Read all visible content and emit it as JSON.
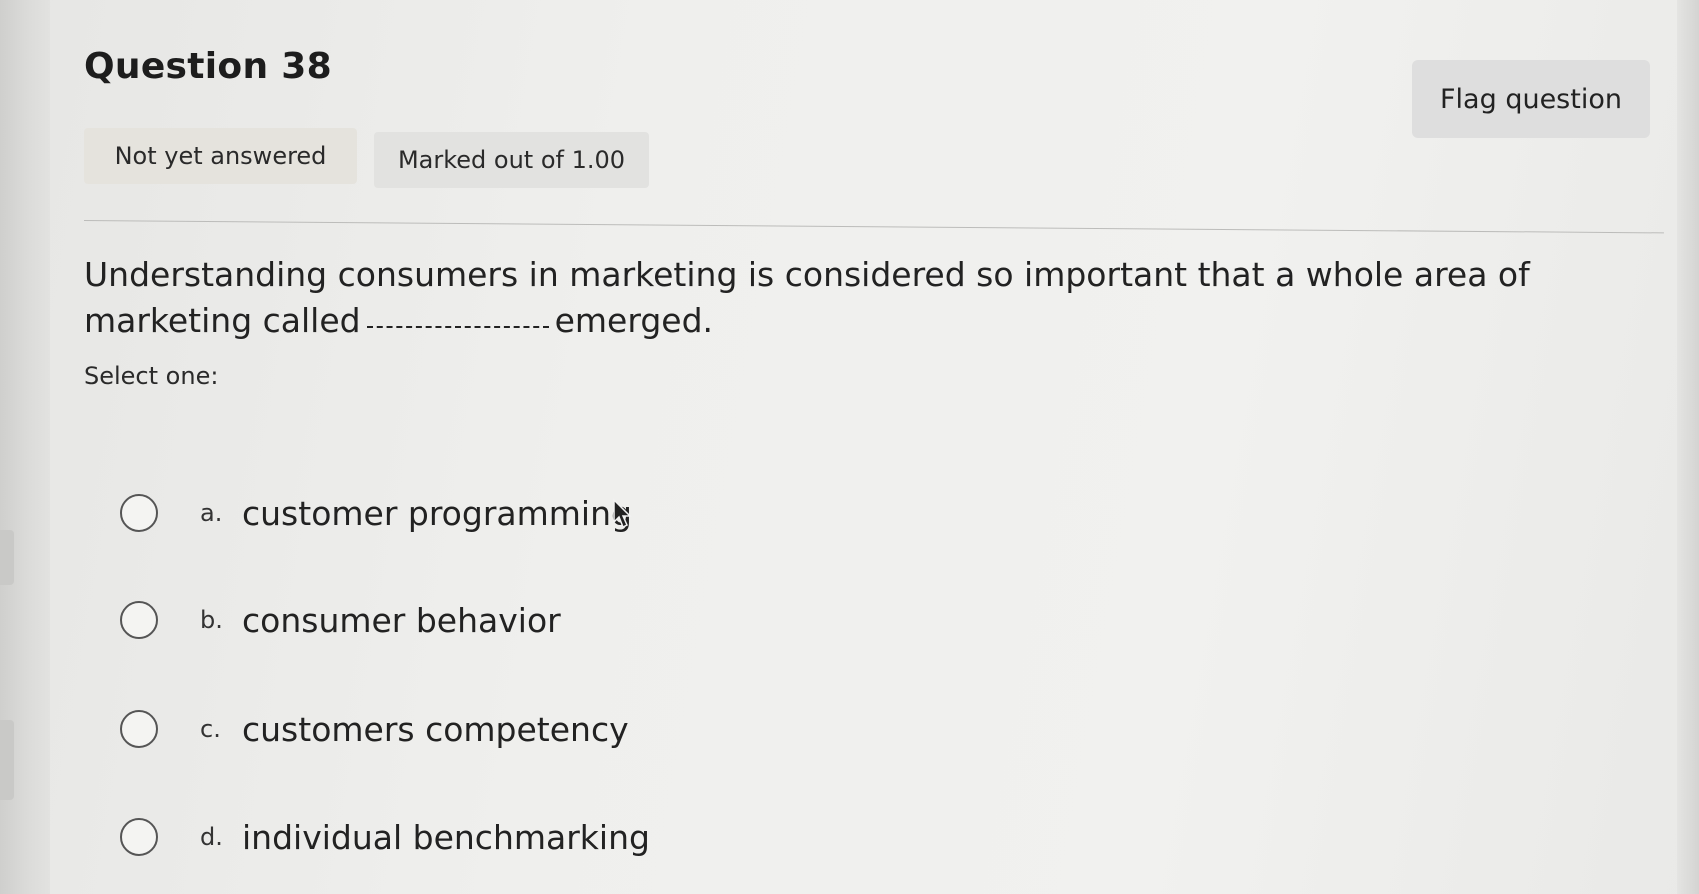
{
  "question": {
    "title": "Question 38",
    "status": "Not yet answered",
    "marks": "Marked out of 1.00",
    "flag_label": "Flag question",
    "text_before": "Understanding consumers in marketing is considered so important that a whole area of marketing called",
    "text_after": "emerged.",
    "select_label": "Select one:"
  },
  "options": [
    {
      "letter": "a.",
      "text": "customer programming",
      "selected": false
    },
    {
      "letter": "b.",
      "text": "consumer behavior",
      "selected": false
    },
    {
      "letter": "c.",
      "text": "customers competency",
      "selected": false
    },
    {
      "letter": "d.",
      "text": "individual benchmarking",
      "selected": false
    }
  ],
  "icons": {
    "cursor": "mouse-pointer-icon",
    "radio": "radio-button-icon"
  },
  "colors": {
    "background": "#f0f0ee",
    "badge": "#e4e3df",
    "flag_button": "#dedede",
    "text": "#222222"
  }
}
